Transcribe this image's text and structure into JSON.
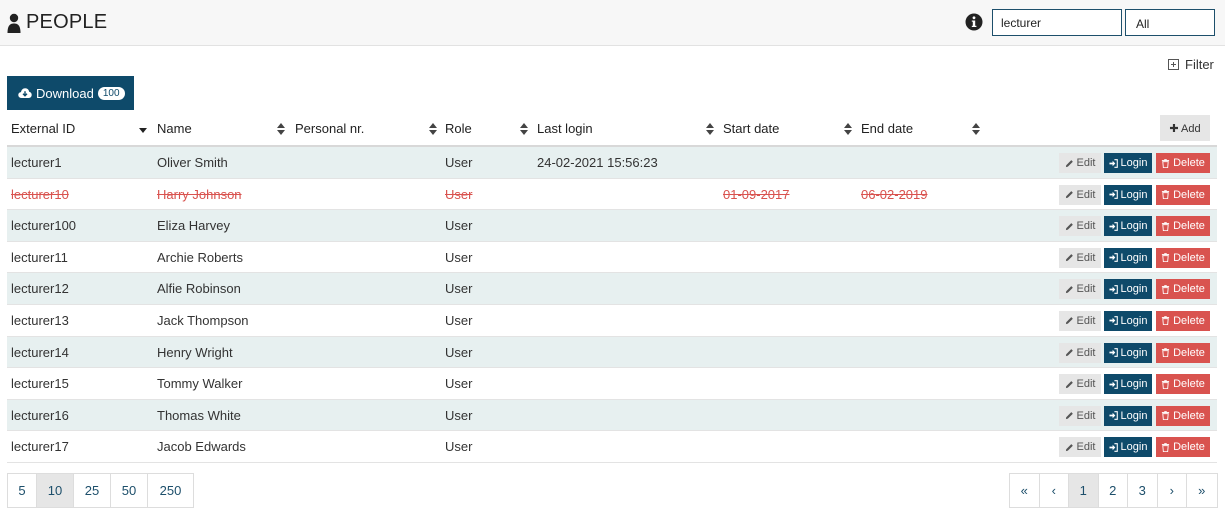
{
  "header": {
    "title": "PEOPLE",
    "search_value": "lecturer",
    "scope_value": "All"
  },
  "toolbar": {
    "filter_label": "Filter",
    "download_label": "Download",
    "download_count": "100",
    "add_label": "Add"
  },
  "table": {
    "columns": [
      "External ID",
      "Name",
      "Personal nr.",
      "Role",
      "Last login",
      "Start date",
      "End date"
    ],
    "rows": [
      {
        "external_id": "lecturer1",
        "name": "Oliver Smith",
        "personal_nr": "",
        "role": "User",
        "last_login": "24-02-2021 15:56:23",
        "start_date": "",
        "end_date": "",
        "deleted": false
      },
      {
        "external_id": "lecturer10",
        "name": "Harry Johnson",
        "personal_nr": "",
        "role": "User",
        "last_login": "",
        "start_date": "01-09-2017",
        "end_date": "06-02-2019",
        "deleted": true
      },
      {
        "external_id": "lecturer100",
        "name": "Eliza Harvey",
        "personal_nr": "",
        "role": "User",
        "last_login": "",
        "start_date": "",
        "end_date": "",
        "deleted": false
      },
      {
        "external_id": "lecturer11",
        "name": "Archie Roberts",
        "personal_nr": "",
        "role": "User",
        "last_login": "",
        "start_date": "",
        "end_date": "",
        "deleted": false
      },
      {
        "external_id": "lecturer12",
        "name": "Alfie Robinson",
        "personal_nr": "",
        "role": "User",
        "last_login": "",
        "start_date": "",
        "end_date": "",
        "deleted": false
      },
      {
        "external_id": "lecturer13",
        "name": "Jack  Thompson",
        "personal_nr": "",
        "role": "User",
        "last_login": "",
        "start_date": "",
        "end_date": "",
        "deleted": false
      },
      {
        "external_id": "lecturer14",
        "name": "Henry Wright",
        "personal_nr": "",
        "role": "User",
        "last_login": "",
        "start_date": "",
        "end_date": "",
        "deleted": false
      },
      {
        "external_id": "lecturer15",
        "name": "Tommy Walker",
        "personal_nr": "",
        "role": "User",
        "last_login": "",
        "start_date": "",
        "end_date": "",
        "deleted": false
      },
      {
        "external_id": "lecturer16",
        "name": "Thomas White",
        "personal_nr": "",
        "role": "User",
        "last_login": "",
        "start_date": "",
        "end_date": "",
        "deleted": false
      },
      {
        "external_id": "lecturer17",
        "name": "Jacob Edwards",
        "personal_nr": "",
        "role": "User",
        "last_login": "",
        "start_date": "",
        "end_date": "",
        "deleted": false
      }
    ],
    "actions": {
      "edit": "Edit",
      "login": "Login",
      "delete": "Delete"
    }
  },
  "pagination": {
    "page_sizes": [
      "5",
      "10",
      "25",
      "50",
      "250"
    ],
    "active_page_size": "10",
    "pages": [
      "«",
      "‹",
      "1",
      "2",
      "3",
      "›",
      "»"
    ],
    "active_page": "1"
  },
  "colors": {
    "primary": "#0e4a6a",
    "danger": "#d9534f",
    "row_stripe": "#e7f0f0"
  }
}
